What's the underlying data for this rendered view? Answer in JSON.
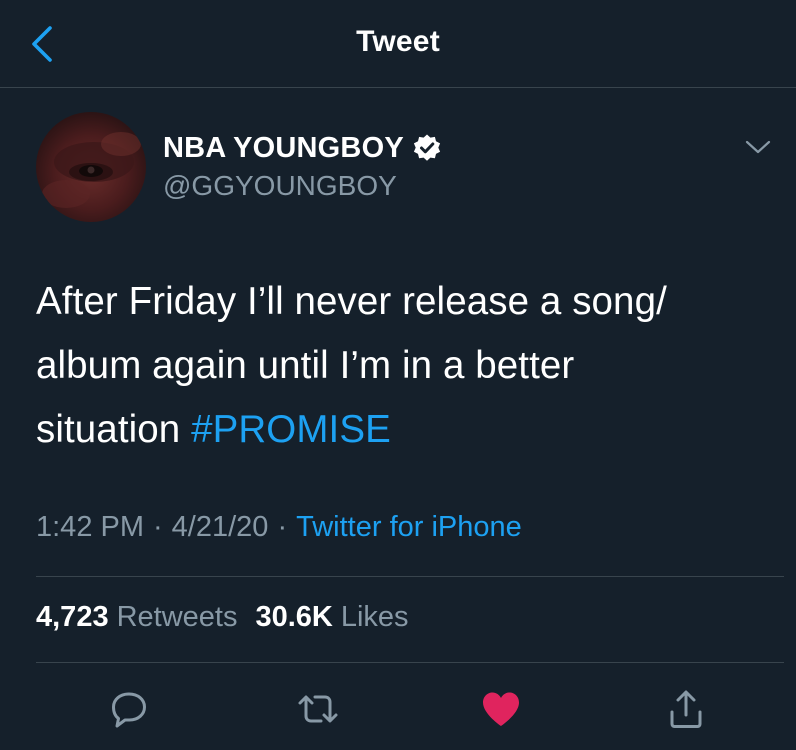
{
  "header": {
    "title": "Tweet",
    "back_icon": "chevron-left-icon"
  },
  "author": {
    "display_name": "NBA YOUNGBOY",
    "handle": "@GGYOUNGBOY",
    "verified": true,
    "verified_icon": "verified-badge-icon",
    "menu_icon": "chevron-down-icon"
  },
  "tweet": {
    "lines": [
      "After Friday I’ll never release a song/",
      "album again until I’m in a better",
      "situation "
    ],
    "hashtag": "#PROMISE"
  },
  "meta": {
    "time": "1:42 PM",
    "separator": "·",
    "date": "4/21/20",
    "source": "Twitter for iPhone"
  },
  "stats": {
    "retweets_count": "4,723",
    "retweets_label": "Retweets",
    "likes_count": "30.6K",
    "likes_label": "Likes"
  },
  "actions": {
    "reply_icon": "reply-icon",
    "retweet_icon": "retweet-icon",
    "like_icon": "heart-icon",
    "share_icon": "share-icon",
    "liked": true
  },
  "colors": {
    "background": "#15202b",
    "accent": "#1da1f2",
    "secondary_text": "#8899a6",
    "divider": "#38444d",
    "like": "#e0245e"
  }
}
